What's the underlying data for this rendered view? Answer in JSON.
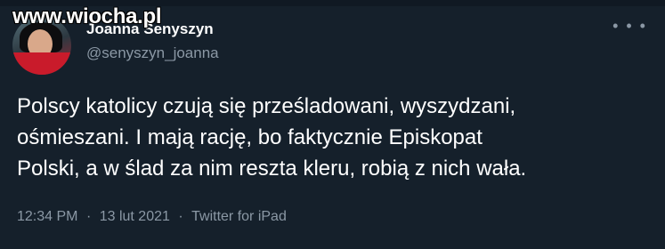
{
  "watermark": {
    "text": "www.wiocha.pl"
  },
  "tweet": {
    "display_name": "Joanna Senyszyn",
    "handle": "@senyszyn_joanna",
    "body": "Polscy katolicy czują się prześladowani, wyszydzani,\nośmieszani. I mają rację, bo faktycznie Episkopat\nPolski, a w ślad za nim reszta kleru, robią z nich wała.",
    "time": "12:34 PM",
    "date": "13 lut 2021",
    "separator": "·",
    "source": "Twitter for iPad"
  },
  "icons": {
    "avatar": "profile-photo",
    "more": "more-dots-icon"
  },
  "colors": {
    "background": "#15202b",
    "text": "#ffffff",
    "secondary": "#8b98a5"
  }
}
